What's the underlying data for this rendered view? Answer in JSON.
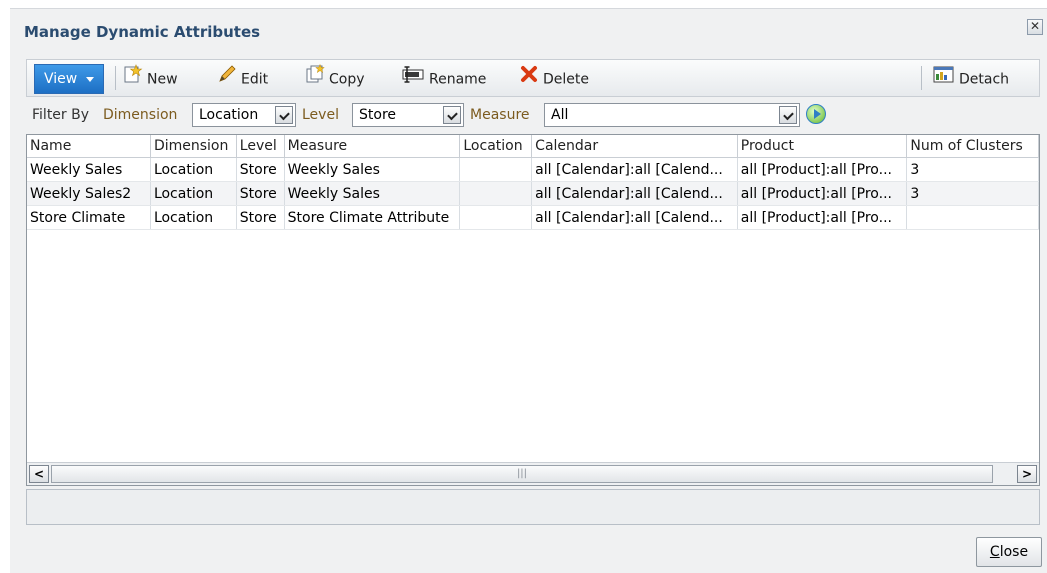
{
  "dialog": {
    "title": "Manage Dynamic Attributes",
    "close_icon": "close-icon"
  },
  "toolbar": {
    "view_label": "View",
    "new_label": "New",
    "edit_label": "Edit",
    "copy_label": "Copy",
    "rename_label": "Rename",
    "delete_label": "Delete",
    "detach_label": "Detach",
    "icons": [
      "new-icon",
      "edit-pencil-icon",
      "copy-icon",
      "rename-icon",
      "delete-x-icon",
      "detach-icon"
    ]
  },
  "filter": {
    "filter_by_label": "Filter By",
    "dimension_label": "Dimension",
    "dimension_value": "Location",
    "level_label": "Level",
    "level_value": "Store",
    "measure_label": "Measure",
    "measure_value": "All"
  },
  "table": {
    "columns": [
      "Name",
      "Dimension",
      "Level",
      "Measure",
      "Location",
      "Calendar",
      "Product",
      "Num of Clusters"
    ],
    "rows": [
      [
        "Weekly Sales",
        "Location",
        "Store",
        "Weekly Sales",
        "",
        "all [Calendar]:all [Calend...",
        "all [Product]:all [Pro...",
        "3"
      ],
      [
        "Weekly Sales2",
        "Location",
        "Store",
        "Weekly Sales",
        "",
        "all [Calendar]:all [Calend...",
        "all [Product]:all [Pro...",
        "3"
      ],
      [
        "Store Climate",
        "Location",
        "Store",
        "Store Climate Attribute",
        "",
        "all [Calendar]:all [Calend...",
        "all [Product]:all [Pro...",
        ""
      ]
    ]
  },
  "footer": {
    "close_label": "Close"
  },
  "colors": {
    "title": "#2b4c70",
    "view_button": "#1d6fc4",
    "delete_icon": "#d93a12"
  }
}
